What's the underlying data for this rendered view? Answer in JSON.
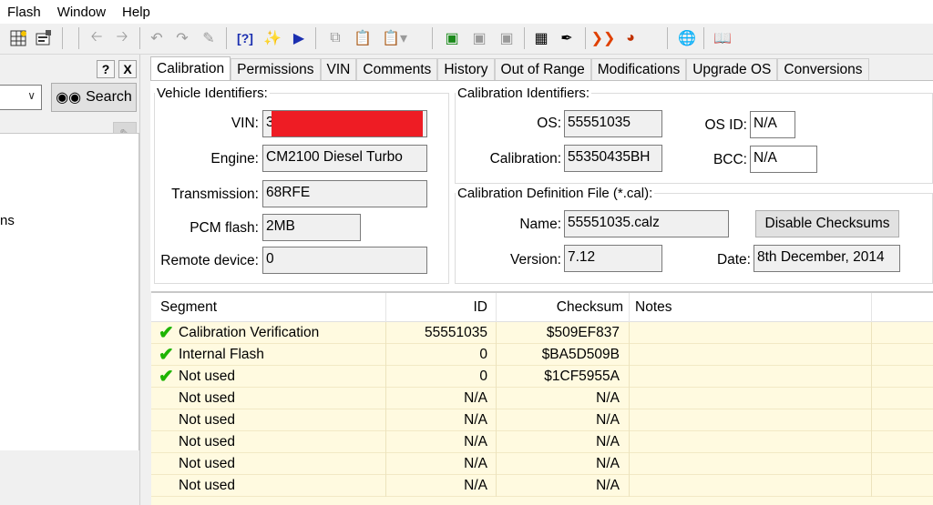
{
  "menu": [
    "Flash",
    "Window",
    "Help"
  ],
  "toolbar_icons": [
    "grid-icon",
    "properties-icon",
    "back-icon",
    "forward-icon",
    "undo-icon",
    "redo-icon",
    "erase-icon",
    "help-icon",
    "sparkle-icon",
    "play-icon",
    "copy-icon",
    "paste-icon",
    "paste-dropdown-icon",
    "vehicle-icon",
    "vehicle2-icon",
    "vehicle3-icon",
    "chip-icon",
    "probe-icon",
    "wave-icon",
    "gauge-icon",
    "globe-icon",
    "book-icon"
  ],
  "left": {
    "help_label": "?",
    "close_label": "X",
    "search_label": "Search",
    "truncated_text": "ns"
  },
  "tabs": [
    "Calibration",
    "Permissions",
    "VIN",
    "Comments",
    "History",
    "Out of Range",
    "Modifications",
    "Upgrade OS",
    "Conversions"
  ],
  "vehicle": {
    "legend": "Vehicle Identifiers:",
    "vin_label": "VIN:",
    "vin_value": "3",
    "engine_label": "Engine:",
    "engine_value": "CM2100 Diesel Turbo",
    "transmission_label": "Transmission:",
    "transmission_value": "68RFE",
    "pcm_label": "PCM flash:",
    "pcm_value": "2MB",
    "remote_label": "Remote device:",
    "remote_value": "0"
  },
  "calibration": {
    "legend": "Calibration Identifiers:",
    "os_label": "OS:",
    "os_value": "55551035",
    "osid_label": "OS ID:",
    "osid_value": "N/A",
    "cal_label": "Calibration:",
    "cal_value": "55350435BH",
    "bcc_label": "BCC:",
    "bcc_value": "N/A"
  },
  "caldef": {
    "legend": "Calibration Definition File (*.cal):",
    "name_label": "Name:",
    "name_value": "55551035.calz",
    "version_label": "Version:",
    "version_value": "7.12",
    "date_label": "Date:",
    "date_value": "8th December, 2014",
    "disable_label": "Disable Checksums"
  },
  "grid": {
    "columns": [
      "Segment",
      "ID",
      "Checksum",
      "Notes"
    ],
    "rows": [
      {
        "check": true,
        "segment": "Calibration Verification",
        "id": "55551035",
        "checksum": "$509EF837",
        "notes": ""
      },
      {
        "check": true,
        "segment": "Internal Flash",
        "id": "0",
        "checksum": "$BA5D509B",
        "notes": ""
      },
      {
        "check": true,
        "segment": "Not used",
        "id": "0",
        "checksum": "$1CF5955A",
        "notes": ""
      },
      {
        "check": false,
        "segment": "Not used",
        "id": "N/A",
        "checksum": "N/A",
        "notes": ""
      },
      {
        "check": false,
        "segment": "Not used",
        "id": "N/A",
        "checksum": "N/A",
        "notes": ""
      },
      {
        "check": false,
        "segment": "Not used",
        "id": "N/A",
        "checksum": "N/A",
        "notes": ""
      },
      {
        "check": false,
        "segment": "Not used",
        "id": "N/A",
        "checksum": "N/A",
        "notes": ""
      },
      {
        "check": false,
        "segment": "Not used",
        "id": "N/A",
        "checksum": "N/A",
        "notes": ""
      }
    ]
  },
  "colors": {
    "grid_bg": "#fffae0",
    "check": "#1eb400",
    "redaction": "#ee1c24"
  }
}
